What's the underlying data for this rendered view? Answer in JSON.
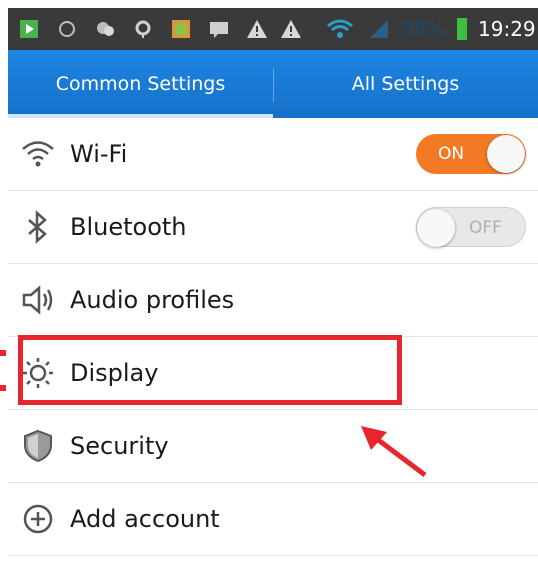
{
  "status_bar": {
    "battery_percent": "98%",
    "time": "19:29",
    "icons": [
      "app-icon",
      "sync-icon",
      "chat-icon",
      "location-icon",
      "gallery-icon",
      "message-icon",
      "warning-icon",
      "warning-icon",
      "wifi-signal-icon",
      "cell-signal-icon",
      "battery-icon"
    ]
  },
  "tabs": [
    {
      "label": "Common Settings",
      "selected": true
    },
    {
      "label": "All Settings",
      "selected": false
    }
  ],
  "settings": [
    {
      "label": "Wi-Fi",
      "icon": "wifi-icon",
      "toggle": "ON"
    },
    {
      "label": "Bluetooth",
      "icon": "bluetooth-icon",
      "toggle": "OFF"
    },
    {
      "label": "Audio profiles",
      "icon": "speaker-icon"
    },
    {
      "label": "Display",
      "icon": "brightness-icon"
    },
    {
      "label": "Security",
      "icon": "shield-icon"
    },
    {
      "label": "Add account",
      "icon": "add-circle-icon"
    }
  ],
  "colors": {
    "tab_bar": "#1670c8",
    "toggle_on": "#f27a25",
    "highlight": "#e8242c",
    "status_bar": "#3a3a3a"
  }
}
